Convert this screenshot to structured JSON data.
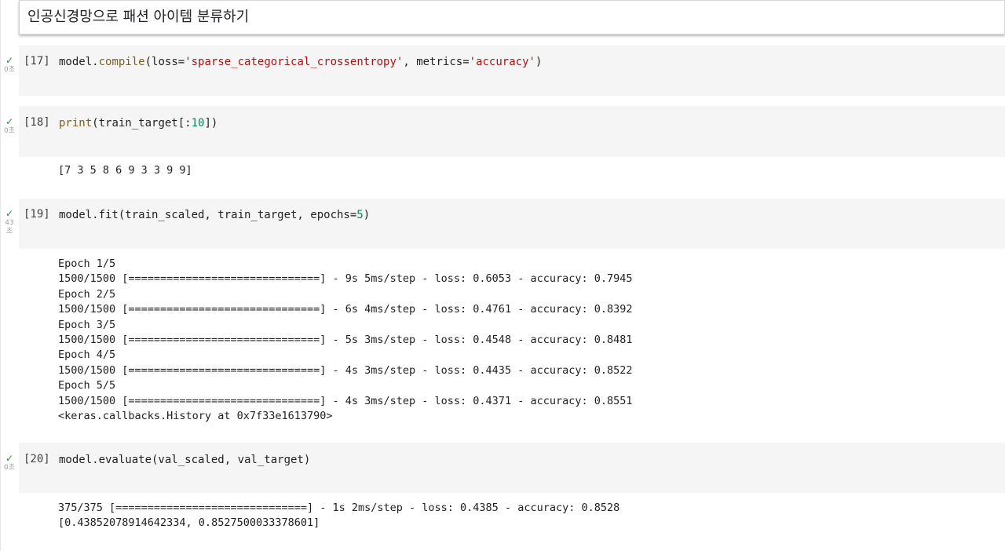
{
  "title": "인공신경망으로 패션 아이템 분류하기",
  "status_icon": "check-icon",
  "cells": [
    {
      "exec": "[17]",
      "time": "0초",
      "code": {
        "p1": "model",
        "p2": ".",
        "p3": "compile",
        "p4": "(loss=",
        "p5": "'sparse_categorical_crossentropy'",
        "p6": ", metrics=",
        "p7": "'accuracy'",
        "p8": ")"
      },
      "output": []
    },
    {
      "exec": "[18]",
      "time": "0초",
      "code": {
        "p1": "print",
        "p2": "(train_target[:",
        "p3": "10",
        "p4": "])"
      },
      "output": [
        "[7 3 5 8 6 9 3 3 9 9]"
      ]
    },
    {
      "exec": "[19]",
      "time": "43초",
      "code": {
        "p1": "model.fit(train_scaled, train_target, epochs=",
        "p2": "5",
        "p3": ")"
      },
      "output": [
        "Epoch 1/5",
        "1500/1500 [==============================] - 9s 5ms/step - loss: 0.6053 - accuracy: 0.7945",
        "Epoch 2/5",
        "1500/1500 [==============================] - 6s 4ms/step - loss: 0.4761 - accuracy: 0.8392",
        "Epoch 3/5",
        "1500/1500 [==============================] - 5s 3ms/step - loss: 0.4548 - accuracy: 0.8481",
        "Epoch 4/5",
        "1500/1500 [==============================] - 4s 3ms/step - loss: 0.4435 - accuracy: 0.8522",
        "Epoch 5/5",
        "1500/1500 [==============================] - 4s 3ms/step - loss: 0.4371 - accuracy: 0.8551",
        "<keras.callbacks.History at 0x7f33e1613790>"
      ]
    },
    {
      "exec": "[20]",
      "time": "0초",
      "code": {
        "p1": "model.evaluate(val_scaled, val_target)"
      },
      "output": [
        "375/375 [==============================] - 1s 2ms/step - loss: 0.4385 - accuracy: 0.8528",
        "[0.43852078914642334, 0.8527500033378601]"
      ]
    }
  ]
}
